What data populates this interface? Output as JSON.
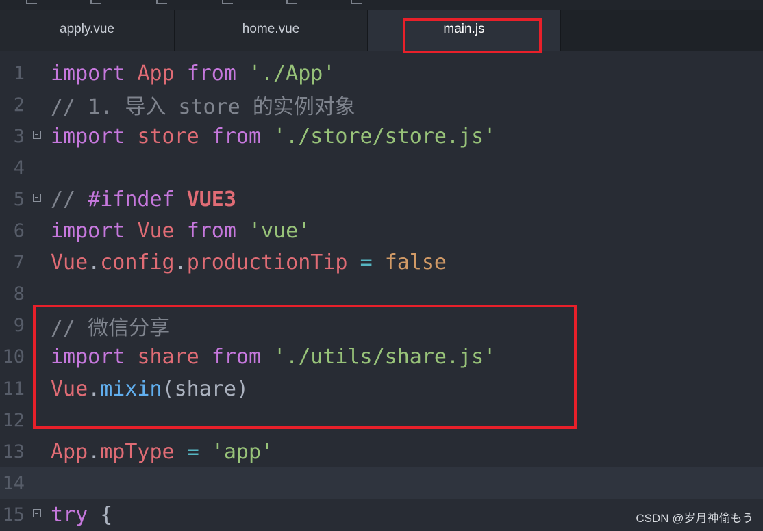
{
  "tabs": [
    {
      "label": "apply.vue",
      "active": false
    },
    {
      "label": "home.vue",
      "active": false
    },
    {
      "label": "main.js",
      "active": true
    }
  ],
  "editor": {
    "current_line": 14,
    "lines": [
      {
        "num": "1",
        "fold": false,
        "tokens": [
          {
            "t": "import",
            "c": "kw"
          },
          {
            "t": " "
          },
          {
            "t": "App",
            "c": "id"
          },
          {
            "t": " "
          },
          {
            "t": "from",
            "c": "kw"
          },
          {
            "t": " "
          },
          {
            "t": "'./App'",
            "c": "str"
          }
        ]
      },
      {
        "num": "2",
        "fold": false,
        "tokens": [
          {
            "t": "// 1. ",
            "c": "cm"
          },
          {
            "t": "导入",
            "c": "cm"
          },
          {
            "t": " store ",
            "c": "cm"
          },
          {
            "t": "的实例对象",
            "c": "cm"
          }
        ]
      },
      {
        "num": "3",
        "fold": true,
        "tokens": [
          {
            "t": "import",
            "c": "kw"
          },
          {
            "t": " "
          },
          {
            "t": "store",
            "c": "id"
          },
          {
            "t": " "
          },
          {
            "t": "from",
            "c": "kw"
          },
          {
            "t": " "
          },
          {
            "t": "'./store/store.js'",
            "c": "str"
          }
        ]
      },
      {
        "num": "4",
        "fold": false,
        "tokens": []
      },
      {
        "num": "5",
        "fold": true,
        "tokens": [
          {
            "t": "// ",
            "c": "cm"
          },
          {
            "t": "#ifndef",
            "c": "kw"
          },
          {
            "t": " "
          },
          {
            "t": "VUE3",
            "c": "cmbold"
          }
        ]
      },
      {
        "num": "6",
        "fold": false,
        "tokens": [
          {
            "t": "import",
            "c": "kw"
          },
          {
            "t": " "
          },
          {
            "t": "Vue",
            "c": "id"
          },
          {
            "t": " "
          },
          {
            "t": "from",
            "c": "kw"
          },
          {
            "t": " "
          },
          {
            "t": "'vue'",
            "c": "str"
          }
        ]
      },
      {
        "num": "7",
        "fold": false,
        "tokens": [
          {
            "t": "Vue",
            "c": "id"
          },
          {
            "t": ".",
            "c": "plain"
          },
          {
            "t": "config",
            "c": "id"
          },
          {
            "t": ".",
            "c": "plain"
          },
          {
            "t": "productionTip",
            "c": "id"
          },
          {
            "t": " "
          },
          {
            "t": "=",
            "c": "op"
          },
          {
            "t": " "
          },
          {
            "t": "false",
            "c": "bool"
          }
        ]
      },
      {
        "num": "8",
        "fold": false,
        "tokens": []
      },
      {
        "num": "9",
        "fold": false,
        "tokens": [
          {
            "t": "// ",
            "c": "cm"
          },
          {
            "t": "微信分享",
            "c": "cm"
          }
        ]
      },
      {
        "num": "10",
        "fold": false,
        "tokens": [
          {
            "t": "import",
            "c": "kw"
          },
          {
            "t": " "
          },
          {
            "t": "share",
            "c": "id"
          },
          {
            "t": " "
          },
          {
            "t": "from",
            "c": "kw"
          },
          {
            "t": " "
          },
          {
            "t": "'./utils/share.js'",
            "c": "str"
          }
        ]
      },
      {
        "num": "11",
        "fold": false,
        "tokens": [
          {
            "t": "Vue",
            "c": "id"
          },
          {
            "t": ".",
            "c": "plain"
          },
          {
            "t": "mixin",
            "c": "fn"
          },
          {
            "t": "(share)",
            "c": "plain"
          }
        ]
      },
      {
        "num": "12",
        "fold": false,
        "tokens": []
      },
      {
        "num": "13",
        "fold": false,
        "tokens": [
          {
            "t": "App",
            "c": "id"
          },
          {
            "t": ".",
            "c": "plain"
          },
          {
            "t": "mpType",
            "c": "id"
          },
          {
            "t": " "
          },
          {
            "t": "=",
            "c": "op"
          },
          {
            "t": " "
          },
          {
            "t": "'app'",
            "c": "str"
          }
        ]
      },
      {
        "num": "14",
        "fold": false,
        "tokens": []
      },
      {
        "num": "15",
        "fold": true,
        "tokens": [
          {
            "t": "try",
            "c": "kw"
          },
          {
            "t": " "
          },
          {
            "t": "{",
            "c": "plain"
          }
        ]
      }
    ]
  },
  "watermark": "CSDN @岁月神偷もう",
  "colors": {
    "keyword": "#c678dd",
    "identifier": "#e06c75",
    "string": "#98c379",
    "comment": "#7f848e",
    "function": "#61afef",
    "boolean": "#d19a66",
    "operator": "#56b6c2",
    "annotation_red": "#e8202a"
  }
}
